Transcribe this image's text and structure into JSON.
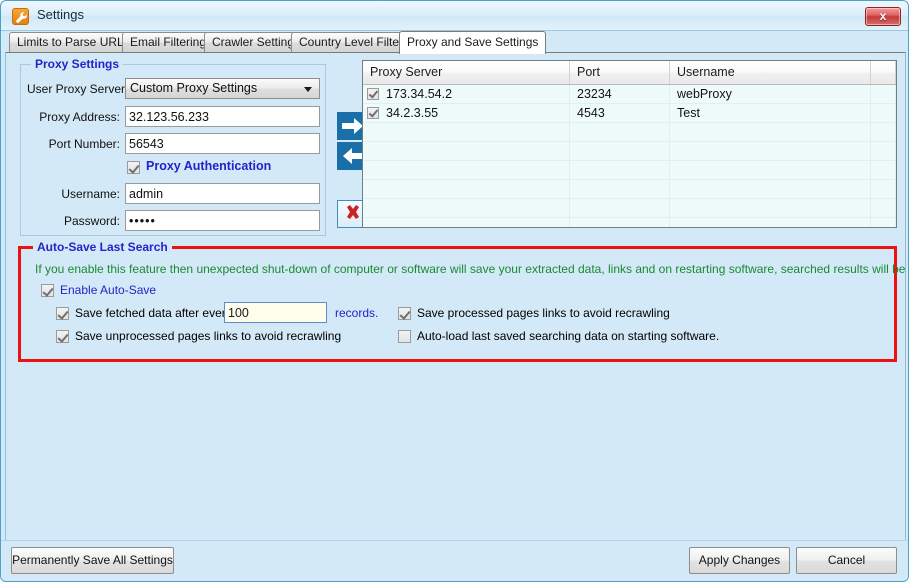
{
  "window": {
    "title": "Settings",
    "icon": "wrench-icon",
    "close_label": "x"
  },
  "tabs": [
    {
      "label": "Limits to Parse URL",
      "active": false
    },
    {
      "label": "Email Filtering",
      "active": false
    },
    {
      "label": "Crawler Settings",
      "active": false
    },
    {
      "label": "Country Level Filters",
      "active": false
    },
    {
      "label": "Proxy and Save Settings",
      "active": true
    }
  ],
  "proxy_settings": {
    "group_title": "Proxy Settings",
    "user_proxy_server_label": "User Proxy Server:",
    "user_proxy_server_value": "Custom Proxy Settings",
    "proxy_address_label": "Proxy Address:",
    "proxy_address_value": "32.123.56.233",
    "port_number_label": "Port Number:",
    "port_number_value": "56543",
    "proxy_authentication_label": "Proxy Authentication",
    "proxy_authentication_checked": true,
    "username_label": "Username:",
    "username_value": "admin",
    "password_label": "Password:",
    "password_value": "•••••"
  },
  "transfer_buttons": [
    {
      "name": "add-proxy-arrow-right",
      "icon": "arrow-right-icon"
    },
    {
      "name": "remove-proxy-arrow-left",
      "icon": "arrow-left-icon"
    },
    {
      "name": "delete-proxy",
      "icon": "red-x-icon"
    }
  ],
  "proxy_grid": {
    "columns": [
      "Proxy Server",
      "Port",
      "Username",
      ""
    ],
    "rows": [
      {
        "checked": true,
        "server": "173.34.54.2",
        "port": "23234",
        "username": "webProxy"
      },
      {
        "checked": true,
        "server": "34.2.3.55",
        "port": "4543",
        "username": "Test"
      }
    ],
    "empty_row_count": 7
  },
  "autosave": {
    "group_title": "Auto-Save Last Search",
    "description": "If you enable this feature then unexpected shut-down of computer or software will save your extracted data, links and on restarting software, searched results will be recovered.",
    "enable_label": "Enable Auto-Save",
    "enable_checked": true,
    "save_fetched_label": "Save fetched data after every",
    "save_fetched_checked": true,
    "records_value": "100",
    "records_suffix": "records.",
    "save_unprocessed_label": "Save unprocessed pages links to avoid recrawling",
    "save_unprocessed_checked": true,
    "save_processed_label": "Save processed pages links to avoid recrawling",
    "save_processed_checked": true,
    "autoload_label": "Auto-load last saved searching data on starting software.",
    "autoload_checked": false,
    "border_color": "#ef1111"
  },
  "footer": {
    "permanently_save_label": "Permanently Save All Settings",
    "apply_label": "Apply Changes",
    "cancel_label": "Cancel"
  }
}
